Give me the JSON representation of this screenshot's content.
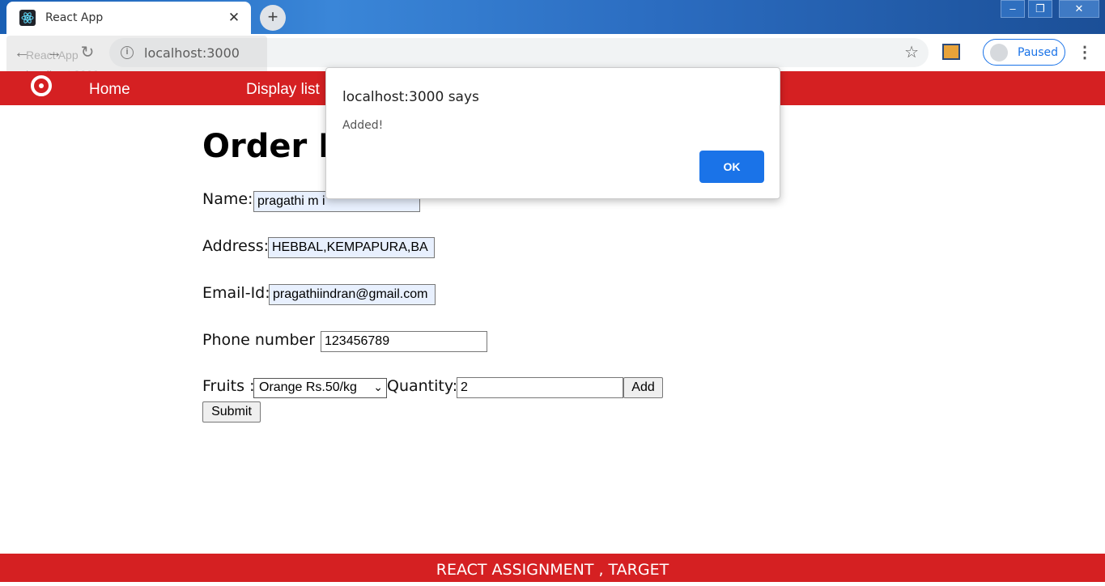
{
  "browser": {
    "tab_title": "React App",
    "tab_close": "✕",
    "new_tab": "+",
    "url": "localhost:3000",
    "profile_label": "Paused",
    "hovercard_title": "React App",
    "hovercard_url": "localhost:3000",
    "window_controls": [
      "–",
      "❐",
      "✕"
    ]
  },
  "nav": {
    "home": "Home",
    "display_list": "Display list"
  },
  "form": {
    "heading": "Order Fo",
    "name_label": "Name:",
    "name_value": "pragathi m i",
    "address_label": "Address:",
    "address_value": "HEBBAL,KEMPAPURA,BA",
    "email_label": "Email-Id:",
    "email_value": "pragathiindran@gmail.com",
    "phone_label": "Phone number :",
    "phone_value": "123456789",
    "fruits_label": "Fruits :",
    "fruits_selected": "Orange Rs.50/kg",
    "quantity_label": "Quantity:",
    "quantity_value": "2",
    "add_label": "Add",
    "submit_label": "Submit"
  },
  "footer": {
    "text": "REACT ASSIGNMENT , TARGET"
  },
  "dialog": {
    "title": "localhost:3000 says",
    "message": "Added!",
    "ok_label": "OK"
  },
  "colors": {
    "brand_red": "#d52022",
    "dialog_button": "#1a73e8",
    "autofill_bg": "#e8f0fe"
  }
}
